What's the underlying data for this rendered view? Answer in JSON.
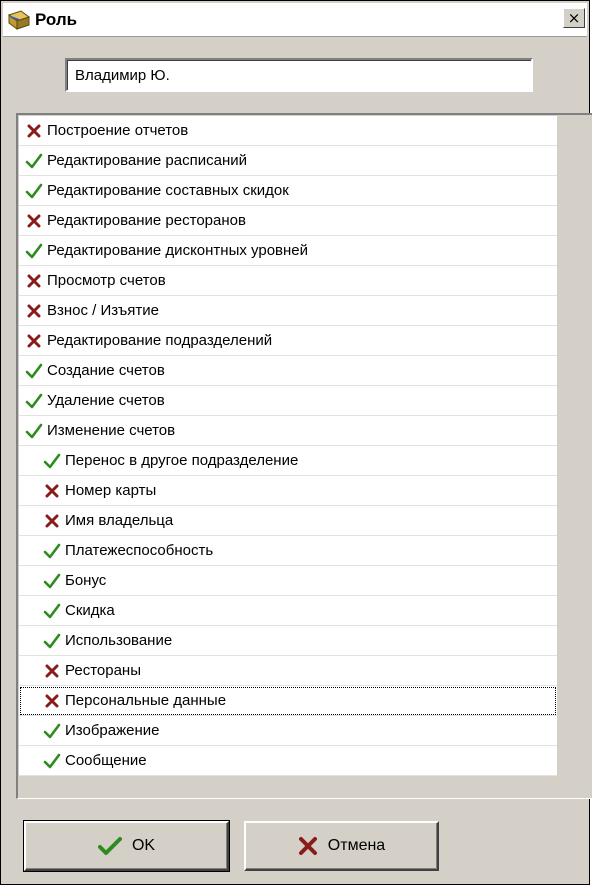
{
  "window": {
    "title": "Роль",
    "close_glyph": "×"
  },
  "name_field": {
    "value": "Владимир Ю."
  },
  "permissions": [
    {
      "label": "Построение отчетов",
      "checked": false,
      "level": 0
    },
    {
      "label": "Редактирование расписаний",
      "checked": true,
      "level": 0
    },
    {
      "label": "Редактирование составных скидок",
      "checked": true,
      "level": 0
    },
    {
      "label": "Редактирование ресторанов",
      "checked": false,
      "level": 0
    },
    {
      "label": "Редактирование дисконтных уровней",
      "checked": true,
      "level": 0
    },
    {
      "label": "Просмотр счетов",
      "checked": false,
      "level": 0
    },
    {
      "label": "Взнос / Изъятие",
      "checked": false,
      "level": 0
    },
    {
      "label": "Редактирование подразделений",
      "checked": false,
      "level": 0
    },
    {
      "label": "Создание счетов",
      "checked": true,
      "level": 0
    },
    {
      "label": "Удаление счетов",
      "checked": true,
      "level": 0
    },
    {
      "label": "Изменение счетов",
      "checked": true,
      "level": 0
    },
    {
      "label": "Перенос в другое подразделение",
      "checked": true,
      "level": 1
    },
    {
      "label": "Номер карты",
      "checked": false,
      "level": 1
    },
    {
      "label": "Имя владельца",
      "checked": false,
      "level": 1
    },
    {
      "label": "Платежеспособность",
      "checked": true,
      "level": 1
    },
    {
      "label": "Бонус",
      "checked": true,
      "level": 1
    },
    {
      "label": "Скидка",
      "checked": true,
      "level": 1
    },
    {
      "label": "Использование",
      "checked": true,
      "level": 1
    },
    {
      "label": "Рестораны",
      "checked": false,
      "level": 1
    },
    {
      "label": "Персональные данные",
      "checked": false,
      "level": 1,
      "focused": true
    },
    {
      "label": "Изображение",
      "checked": true,
      "level": 1
    },
    {
      "label": "Сообщение",
      "checked": true,
      "level": 1
    }
  ],
  "buttons": {
    "ok_label": "OK",
    "cancel_label": "Отмена"
  },
  "colors": {
    "check": "#2e8b1e",
    "cross": "#8b1a1a"
  },
  "icons": {
    "title": "role-icon",
    "check": "check-icon",
    "cross": "cross-icon"
  }
}
